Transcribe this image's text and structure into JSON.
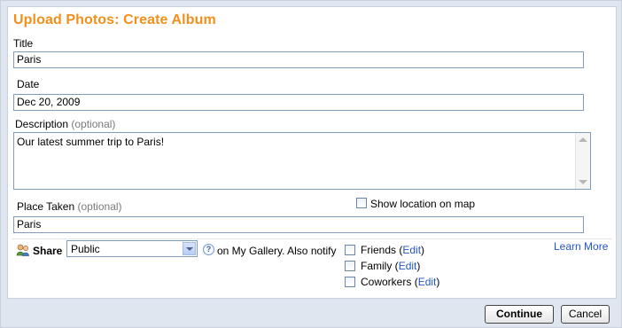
{
  "dialog": {
    "title": "Upload Photos: Create Album",
    "fields": {
      "title_label": "Title",
      "title_value": "Paris",
      "date_label": "Date",
      "date_value": "Dec 20, 2009",
      "description_label": "Description",
      "description_optional": "(optional)",
      "description_value": "Our latest summer trip to Paris!",
      "place_label": "Place Taken",
      "place_optional": "(optional)",
      "place_value": "Paris",
      "show_location_label": "Show location on map"
    },
    "share": {
      "label": "Share",
      "selected": "Public",
      "help_glyph": "?",
      "suffix": "on My Gallery. Also notify",
      "learn_more": "Learn More",
      "notify": [
        {
          "name": "Friends",
          "edit": "Edit"
        },
        {
          "name": "Family",
          "edit": "Edit"
        },
        {
          "name": "Coworkers",
          "edit": "Edit"
        }
      ]
    },
    "buttons": {
      "continue": "Continue",
      "cancel": "Cancel"
    }
  }
}
